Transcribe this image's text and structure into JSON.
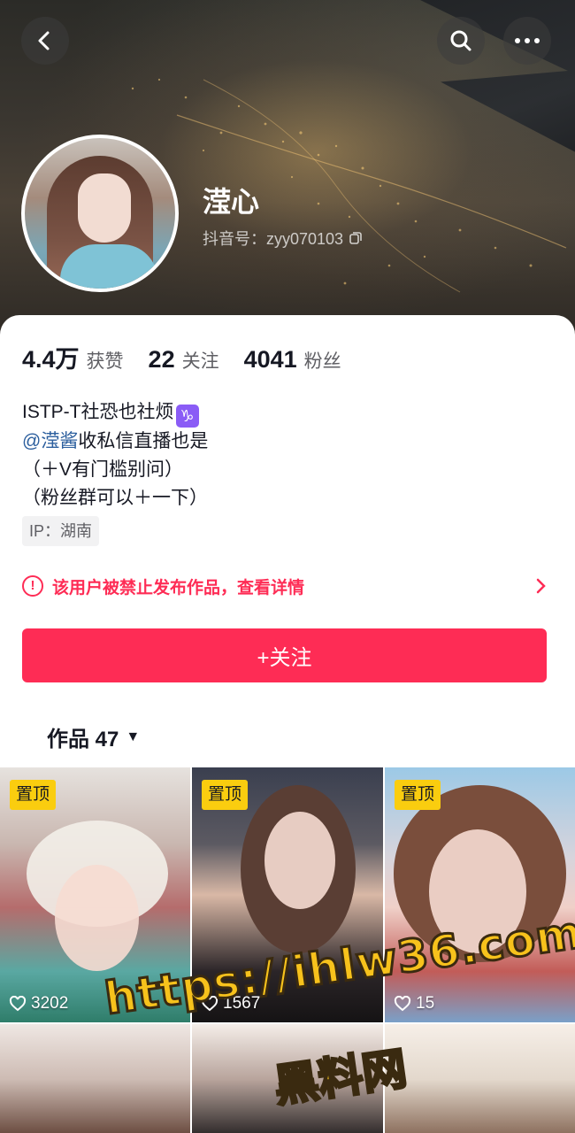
{
  "profile": {
    "name": "滢心",
    "douyin_id": "抖音号：zyy070103"
  },
  "stats": [
    {
      "num": "4.4万",
      "label": "获赞"
    },
    {
      "num": "22",
      "label": "关注"
    },
    {
      "num": "4041",
      "label": "粉丝"
    }
  ],
  "bio": {
    "line1": "ISTP-T社恐也社烦",
    "line1_emoji": "♑",
    "mention": "@滢酱",
    "line2_rest": "收私信直播也是",
    "line3": "（＋V有门槛别问）",
    "line4": "（粉丝群可以＋一下）"
  },
  "ip": "IP：湖南",
  "ban_notice": "该用户被禁止发布作品，查看详情",
  "follow_label": "+关注",
  "works_tab": "作品 47",
  "videos": [
    {
      "pinned": "置顶",
      "likes": "3202"
    },
    {
      "pinned": "置顶",
      "likes": "1567"
    },
    {
      "pinned": "置顶",
      "likes": "15"
    }
  ],
  "watermark": {
    "url": "https://ihlw36.com",
    "text": "黑料网"
  },
  "colors": {
    "accent": "#fe2c55",
    "pin_badge": "#facd0f",
    "mention": "#2c5f9e"
  }
}
